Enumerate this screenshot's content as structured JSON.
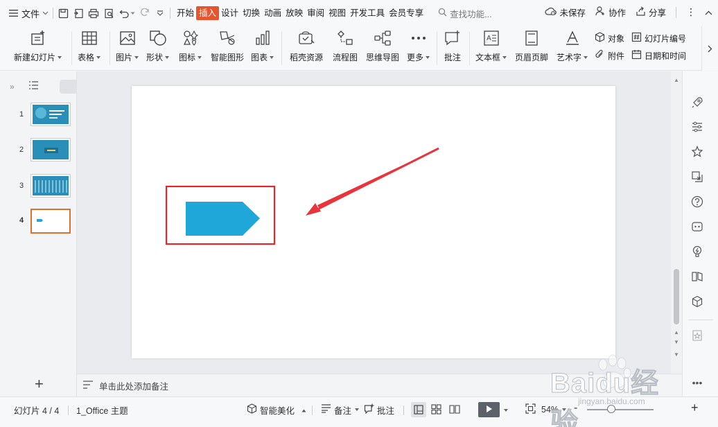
{
  "menubar": {
    "file_label": "文件",
    "tabs": [
      "开始",
      "插入",
      "设计",
      "切换",
      "动画",
      "放映",
      "审阅",
      "视图",
      "开发工具",
      "会员专享"
    ],
    "active_tab_index": 1,
    "search_placeholder": "查找功能...",
    "save_status": "未保存",
    "collab_label": "协作",
    "share_label": "分享"
  },
  "ribbon": {
    "new_slide": "新建幻灯片",
    "table": "表格",
    "picture": "图片",
    "shape": "形状",
    "icon": "图标",
    "smartart": "智能图形",
    "chart": "图表",
    "docer": "稻壳资源",
    "flowchart": "流程图",
    "mindmap": "思维导图",
    "more": "更多",
    "comment": "批注",
    "textbox": "文本框",
    "header_footer": "页眉页脚",
    "wordart": "艺术字",
    "object": "对象",
    "attachment": "附件",
    "slide_number": "幻灯片编号",
    "datetime": "日期和时间"
  },
  "slides": [
    {
      "number": "1"
    },
    {
      "number": "2"
    },
    {
      "number": "3"
    },
    {
      "number": "4"
    }
  ],
  "selected_slide_number": "4",
  "notes": {
    "placeholder": "单击此处添加备注"
  },
  "statusbar": {
    "slide_info": "幻灯片 4 / 4",
    "theme": "1_Office 主题",
    "smart_beautify": "智能美化",
    "notes_label": "备注",
    "comment_label": "批注",
    "zoom": "54%",
    "minus": "-",
    "plus": "+"
  },
  "watermark": {
    "line1": "Baidu经验",
    "line2": "jingyan.baidu.com"
  },
  "colors": {
    "accent_active_tab": "#e8542e",
    "shape_fill": "#1ea7d8",
    "highlight_box": "#e5262a",
    "arrow": "#e8343a",
    "selected_thumb_border": "#e07030"
  },
  "icons": {
    "menu": "hamburger-icon",
    "save": "save-icon",
    "undo": "undo-icon",
    "redo": "redo-icon",
    "play": "play-icon"
  }
}
